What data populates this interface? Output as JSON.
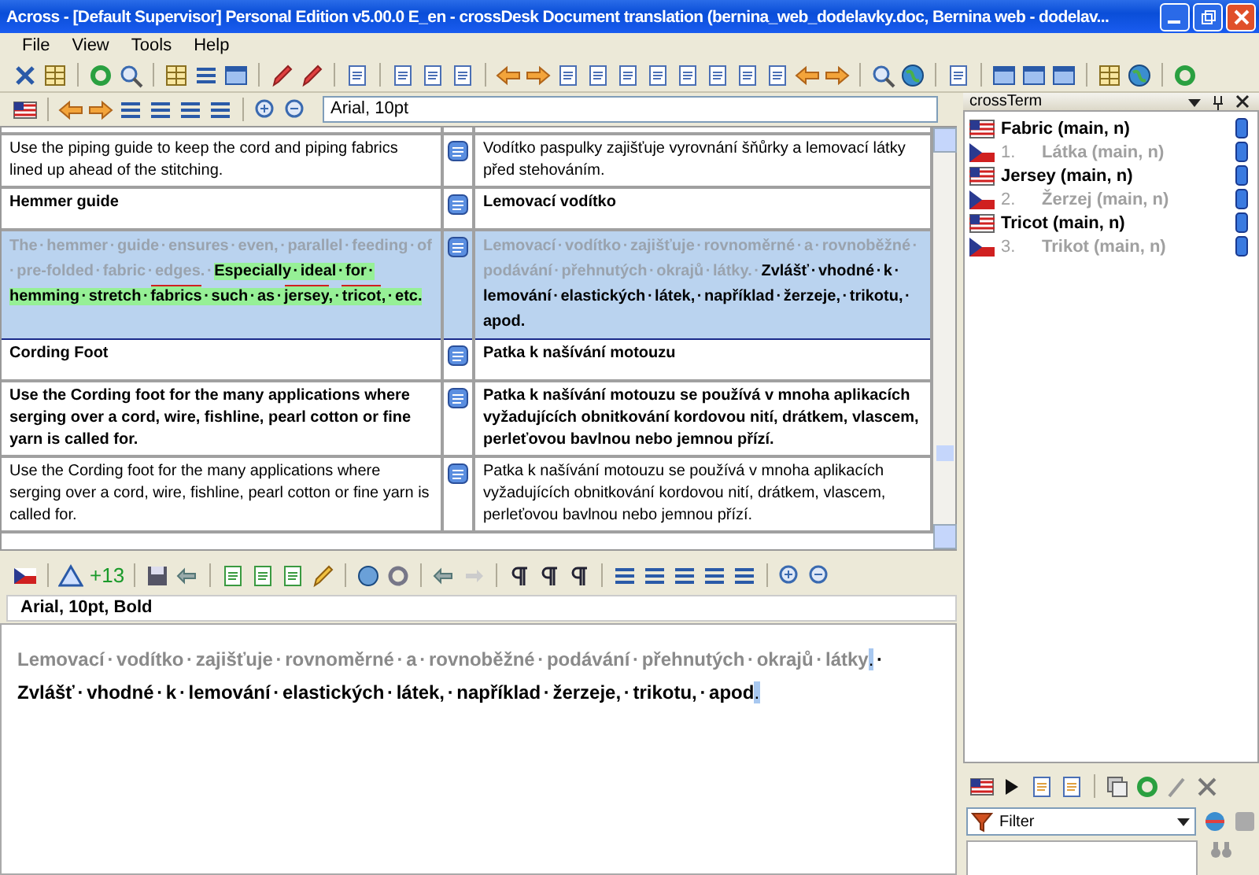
{
  "window": {
    "title": "Across -  [Default Supervisor] Personal Edition v5.00.0 E_en - crossDesk Document translation (bernina_web_dodelavky.doc, Bernina web - dodelav..."
  },
  "menu": [
    {
      "label": "File"
    },
    {
      "label": "View"
    },
    {
      "label": "Tools"
    },
    {
      "label": "Help"
    }
  ],
  "format_field": {
    "value": "Arial, 10pt"
  },
  "table": {
    "rows": [
      {
        "selected": false,
        "source": [
          {
            "kind": "normal",
            "text": "Use the piping guide to keep the cord and piping fabrics lined up ahead of the stitching."
          }
        ],
        "target": [
          {
            "kind": "normal",
            "text": "Vodítko paspulky zajišťuje vyrovnání šňůrky a lemovací látky před stehováním."
          }
        ]
      },
      {
        "selected": false,
        "source": [
          {
            "kind": "bold",
            "text": "Hemmer guide"
          }
        ],
        "target": [
          {
            "kind": "bold",
            "text": "Lemovací vodítko"
          }
        ]
      },
      {
        "selected": true,
        "source": [
          {
            "kind": "done",
            "text": "The · hemmer · guide · ensures · even, · parallel · feeding · of · pre-folded · fabric · edges. · "
          },
          {
            "kind": "highlighted",
            "text": "Especially · ideal · for · hemming · stretch · "
          },
          {
            "kind": "term",
            "text": "fabrics"
          },
          {
            "kind": "highlighted",
            "text": " · such · as · "
          },
          {
            "kind": "term",
            "text": "jersey"
          },
          {
            "kind": "highlighted",
            "text": ", · "
          },
          {
            "kind": "term",
            "text": "tricot"
          },
          {
            "kind": "highlighted",
            "text": ", · etc."
          }
        ],
        "target": [
          {
            "kind": "done",
            "text": "Lemovací · vodítko · zajišťuje · rovnoměrné · a · rovnoběžné · podávání · přehnutých · okrajů · látky. · "
          },
          {
            "kind": "bold",
            "text": "Zvlášť · vhodné · k · lemování · elastických · látek, · například · žerzeje, · trikotu, · apod."
          }
        ]
      },
      {
        "selected": false,
        "source": [
          {
            "kind": "bold",
            "text": "Cording Foot"
          }
        ],
        "target": [
          {
            "kind": "bold",
            "text": "Patka k našívání motouzu"
          }
        ]
      },
      {
        "selected": false,
        "source": [
          {
            "kind": "bold",
            "text": "Use the Cording foot for the many applications where serging over a cord, wire, fishline, pearl cotton or fine yarn is called for."
          }
        ],
        "target": [
          {
            "kind": "bold",
            "text": "Patka k našívání motouzu se používá v mnoha aplikacích vyžadujících obnitkování kordovou nití, drátkem, vlascem, perleťovou bavlnou nebo jemnou přízí."
          }
        ]
      },
      {
        "selected": false,
        "source": [
          {
            "kind": "normal",
            "text": "Use the Cording foot for the many applications where serging over a cord, wire, fishline, pearl cotton or fine yarn is called for."
          }
        ],
        "target": [
          {
            "kind": "normal",
            "text": "Patka k našívání motouzu se používá v mnoha aplikacích vyžadujících obnitkování kordovou nití, drátkem, vlascem, perleťovou bavlnou nebo jemnou přízí."
          }
        ]
      }
    ]
  },
  "editor_toolbar": {
    "counter": "+13"
  },
  "editor_format_field": {
    "value": "Arial, 10pt, Bold"
  },
  "editor": [
    {
      "kind": "done",
      "text": "Lemovací · vodítko · zajišťuje · rovnoměrné · a · rovnoběžné · podávání · přehnutých · okrajů · látky"
    },
    {
      "kind": "mark",
      "text": "."
    },
    {
      "kind": "bold",
      "text": " · Zvlášť · vhodné · k · lemování · elastických · látek, · například · žerzeje, · trikotu, · apod"
    },
    {
      "kind": "mark",
      "text": "."
    }
  ],
  "crossterm": {
    "title": "crossTerm",
    "entries": [
      {
        "kind": "source",
        "text": "Fabric (main, n)"
      },
      {
        "kind": "target",
        "number": "1.",
        "text": "Látka (main, n)"
      },
      {
        "kind": "source",
        "text": "Jersey (main, n)"
      },
      {
        "kind": "target",
        "number": "2.",
        "text": "Žerzej (main, n)"
      },
      {
        "kind": "source",
        "text": "Tricot (main, n)"
      },
      {
        "kind": "target",
        "number": "3.",
        "text": "Trikot (main, n)"
      }
    ],
    "filter": {
      "value": "Filter"
    }
  }
}
